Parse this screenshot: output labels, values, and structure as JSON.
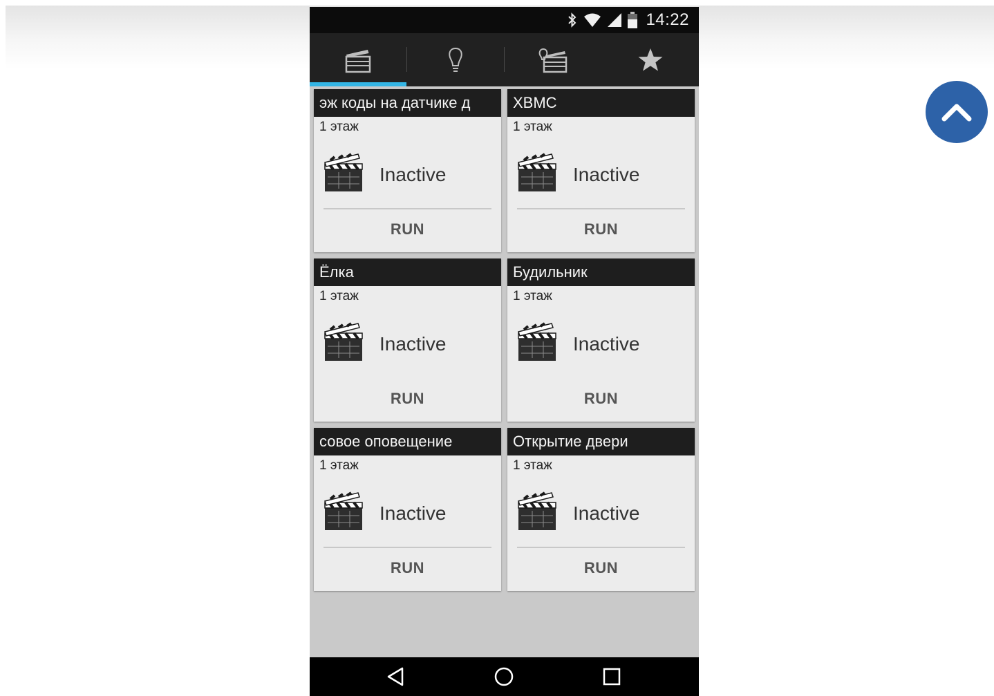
{
  "status_bar": {
    "time": "14:22",
    "icons": [
      "bluetooth-icon",
      "wifi-icon",
      "cellular-signal-icon",
      "battery-icon"
    ]
  },
  "tabs": [
    {
      "icon": "clapperboard-icon",
      "selected": true
    },
    {
      "icon": "lightbulb-icon",
      "selected": false
    },
    {
      "icon": "clapperboard-with-bulb-icon",
      "selected": false
    },
    {
      "icon": "star-icon",
      "selected": false
    }
  ],
  "cards": [
    {
      "title": "эж коды на датчике д",
      "subtitle": "1 этаж",
      "state": "Inactive",
      "action": "RUN"
    },
    {
      "title": "XBMC",
      "subtitle": "1 этаж",
      "state": "Inactive",
      "action": "RUN"
    },
    {
      "title": "Ёлка",
      "subtitle": "1 этаж",
      "state": "Inactive",
      "action": "RUN"
    },
    {
      "title": "Будильник",
      "subtitle": "1 этаж",
      "state": "Inactive",
      "action": "RUN"
    },
    {
      "title": "совое оповещение",
      "subtitle": "1 этаж",
      "state": "Inactive",
      "action": "RUN"
    },
    {
      "title": "Открытие двери",
      "subtitle": "1 этаж",
      "state": "Inactive",
      "action": "RUN"
    }
  ],
  "nav_bar": {
    "buttons": [
      "back-icon",
      "home-icon",
      "recents-icon"
    ]
  },
  "scroll_top_button": {
    "icon": "chevron-up-icon"
  },
  "colors": {
    "tab_indicator": "#33b5e5",
    "card_header": "#1e1e1e",
    "card_body": "#ececec",
    "scroll_top": "#2d62a8"
  }
}
